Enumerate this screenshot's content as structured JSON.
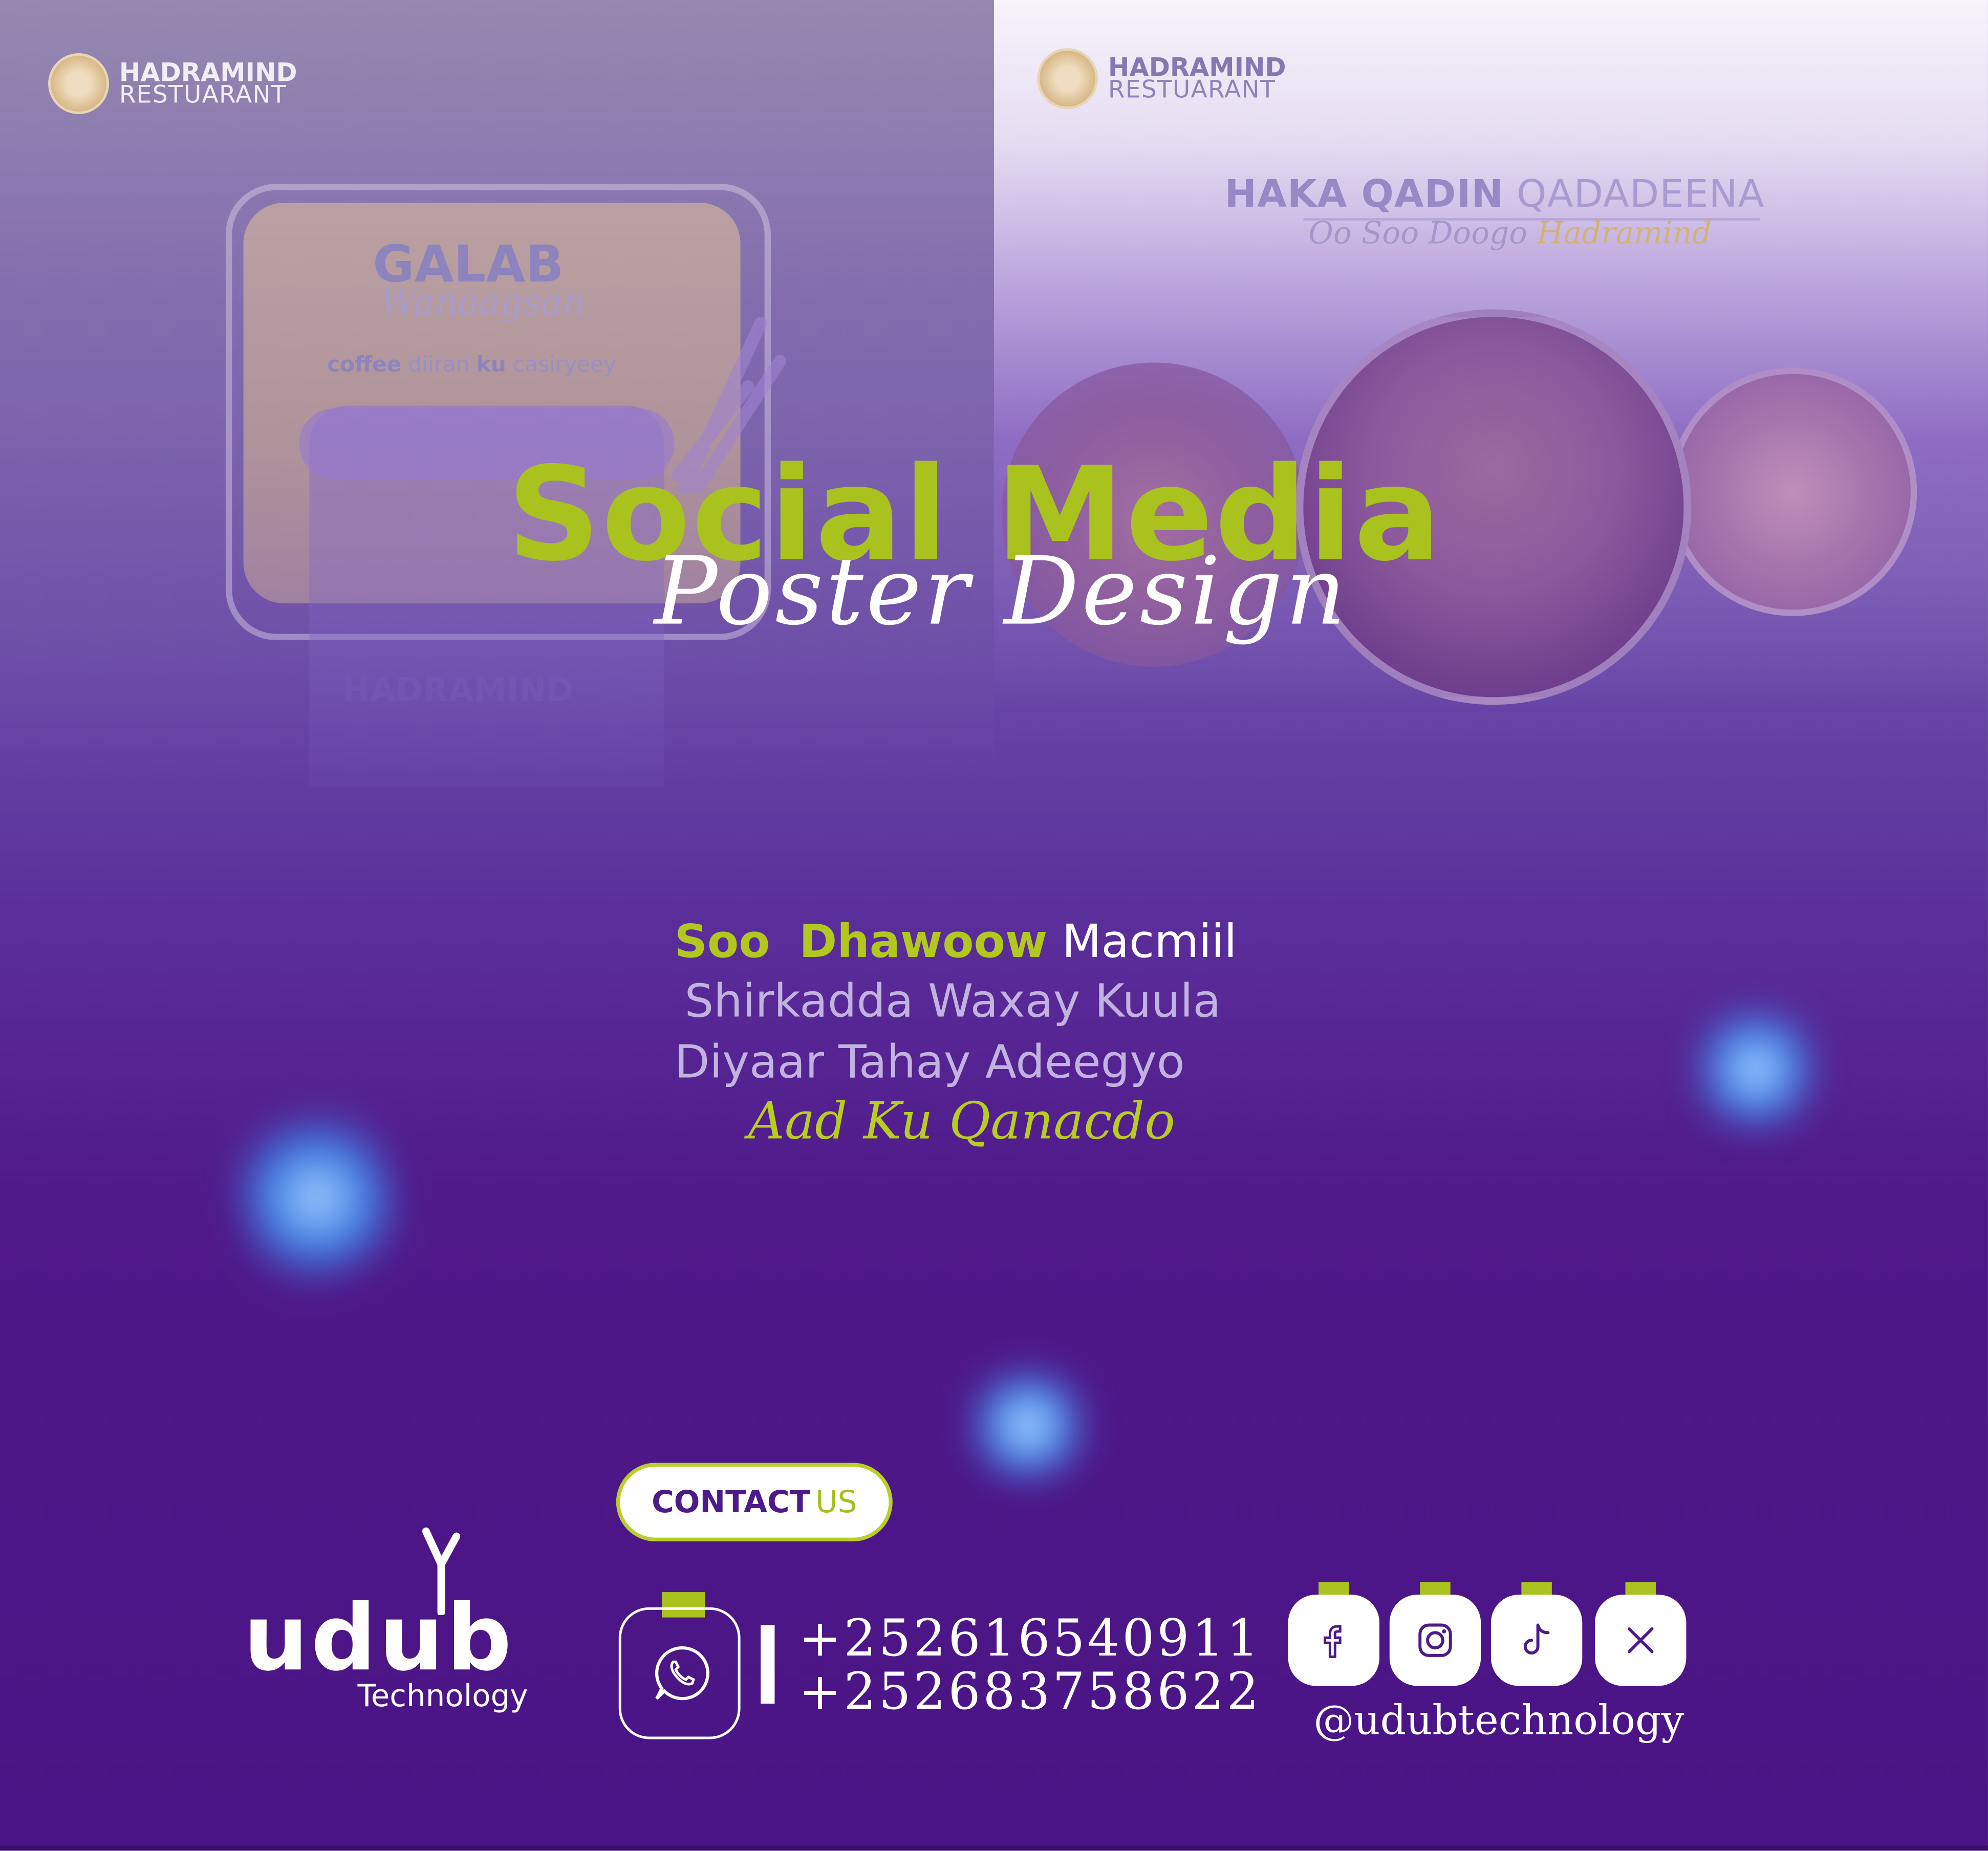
{
  "hadramind_left": {
    "name": "HADRAMIND",
    "sub": "RESTUARANT"
  },
  "hadramind_right": {
    "name": "HADRAMIND",
    "sub": "RESTUARANT"
  },
  "left_card": {
    "title": "GALAB",
    "script": "Wanaagsan",
    "tagline": {
      "a": "coffee",
      "b": "diiran",
      "c": "ku",
      "d": "casiryeey"
    },
    "ghost_logo": "HADRAMIND"
  },
  "right_card": {
    "title_bold": "HAKA QADIN",
    "title_rest": "QADADEENA",
    "script_a": "Oo Soo Doogo",
    "script_b": "Hadramind"
  },
  "hero": {
    "line1": "Social Media",
    "line2": "Poster Design"
  },
  "welcome": {
    "soo": "Soo",
    "dhawoow": "Dhawoow",
    "macmiil": "Macmiil",
    "line2": "Shirkadda Waxay Kuula",
    "line3": "Diyaar Tahay Adeegyo",
    "line4": "Aad Ku Qanacdo"
  },
  "contact": {
    "a": "CONTACT",
    "b": "US"
  },
  "brand": {
    "name": "udub",
    "sub": "Technology"
  },
  "phones": [
    "+252616540911",
    "+252683758622"
  ],
  "social": {
    "icons": [
      "facebook-icon",
      "instagram-icon",
      "tiktok-icon",
      "x-icon"
    ],
    "handle": "@udubtechnology"
  },
  "colors": {
    "accent": "#a9c21e",
    "purple": "#4c1a8a",
    "white": "#ffffff"
  }
}
